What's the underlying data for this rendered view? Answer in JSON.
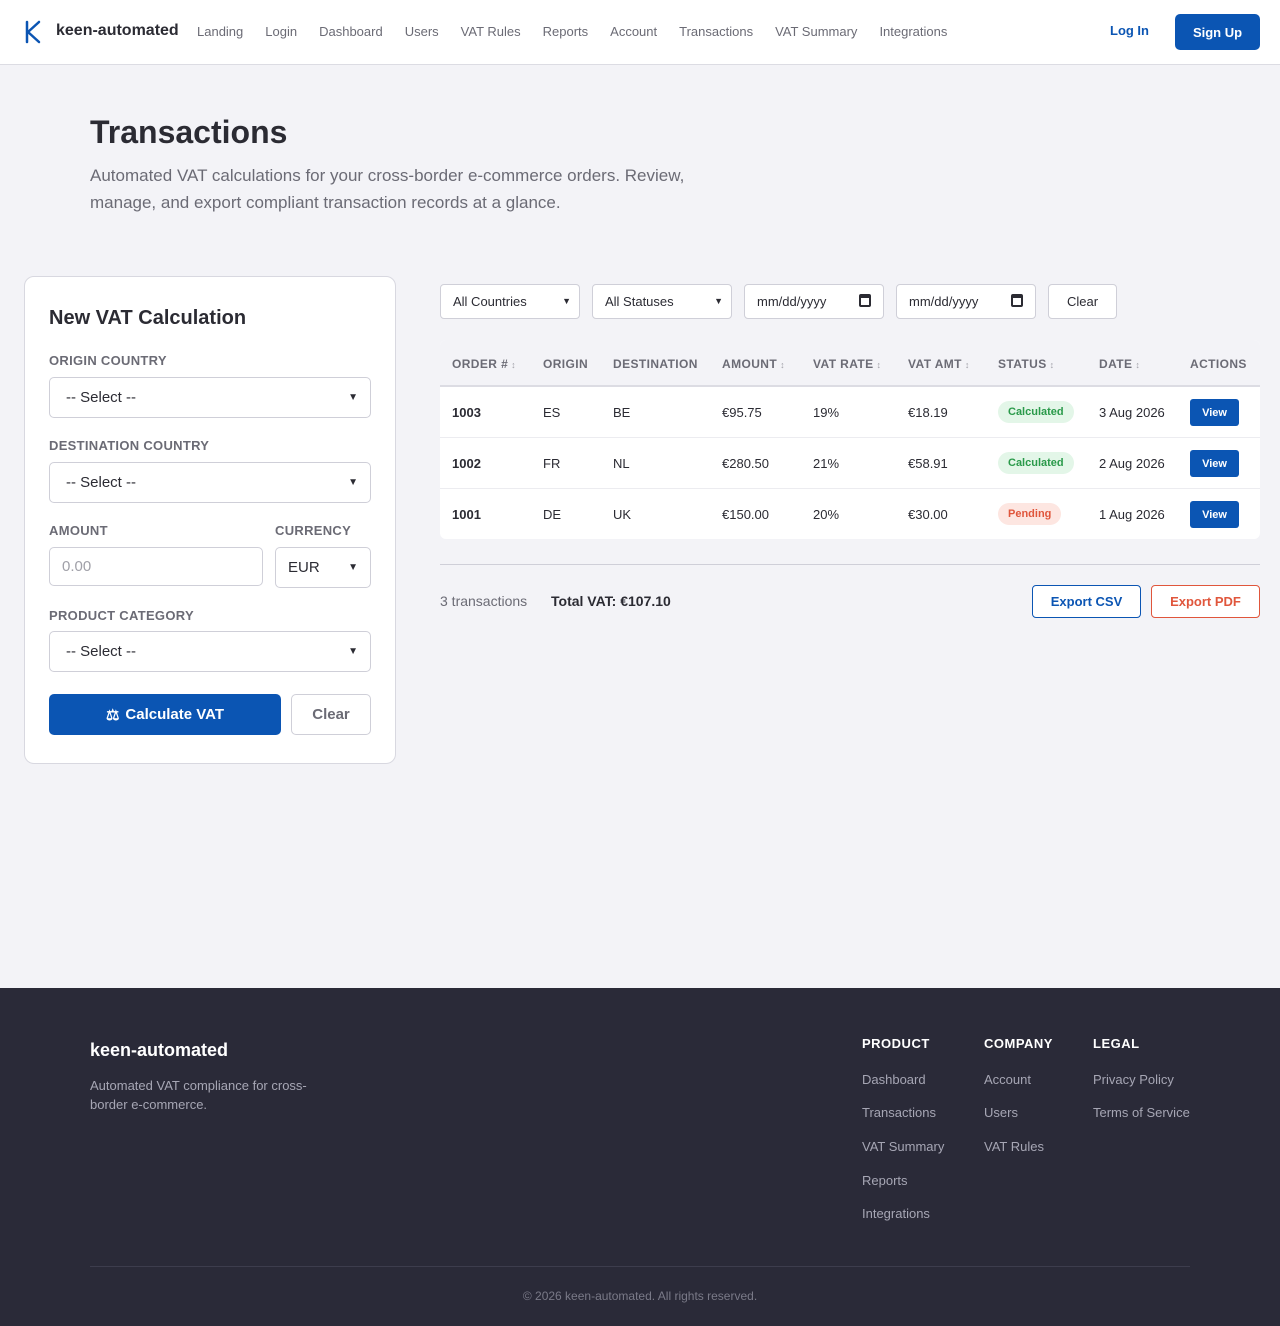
{
  "header": {
    "brand": "keen-automated",
    "nav": [
      "Landing",
      "Login",
      "Dashboard",
      "Users",
      "VAT Rules",
      "Reports",
      "Account",
      "Transactions",
      "VAT Summary",
      "Integrations"
    ],
    "login_label": "Log In",
    "signup_label": "Sign Up",
    "accent_color": "#0b55b3"
  },
  "hero": {
    "title": "Transactions",
    "subtitle": "Automated VAT calculations for your cross-border e-commerce orders. Review, manage, and export compliant transaction records at a glance."
  },
  "form": {
    "title": "New VAT Calculation",
    "origin_label": "ORIGIN COUNTRY",
    "origin_value": "-- Select --",
    "destination_label": "DESTINATION COUNTRY",
    "destination_value": "-- Select --",
    "amount_label": "AMOUNT",
    "amount_placeholder": "0.00",
    "currency_label": "CURRENCY",
    "currency_value": "EUR",
    "category_label": "PRODUCT CATEGORY",
    "category_value": "-- Select --",
    "calculate_icon": "⚖",
    "calculate_label": "Calculate VAT",
    "clear_label": "Clear"
  },
  "filters": {
    "country": "All Countries",
    "status": "All Statuses",
    "date_from": "mm/dd/yyyy",
    "date_to": "mm/dd/yyyy",
    "clear_label": "Clear"
  },
  "table": {
    "headers": [
      "ORDER #",
      "ORIGIN",
      "DESTINATION",
      "AMOUNT",
      "VAT RATE",
      "VAT AMT",
      "STATUS",
      "DATE",
      "ACTIONS"
    ],
    "sort_glyph": "↕",
    "rows": [
      {
        "order": "1003",
        "origin": "ES",
        "destination": "BE",
        "amount": "€95.75",
        "vat_rate": "19%",
        "vat_amt": "€18.19",
        "status": "Calculated",
        "date": "3 Aug 2026",
        "action": "View"
      },
      {
        "order": "1002",
        "origin": "FR",
        "destination": "NL",
        "amount": "€280.50",
        "vat_rate": "21%",
        "vat_amt": "€58.91",
        "status": "Calculated",
        "date": "2 Aug 2026",
        "action": "View"
      },
      {
        "order": "1001",
        "origin": "DE",
        "destination": "UK",
        "amount": "€150.00",
        "vat_rate": "20%",
        "vat_amt": "€30.00",
        "status": "Pending",
        "date": "1 Aug 2026",
        "action": "View"
      }
    ]
  },
  "summary": {
    "count": "3 transactions",
    "total_vat": "Total VAT: €107.10",
    "export_csv": "Export CSV",
    "export_pdf": "Export PDF"
  },
  "footer": {
    "brand": "keen-automated",
    "tagline": "Automated VAT compliance for cross-border e-commerce.",
    "product_title": "PRODUCT",
    "product_links": [
      "Dashboard",
      "Transactions",
      "VAT Summary",
      "Reports",
      "Integrations"
    ],
    "company_title": "COMPANY",
    "company_links": [
      "Account",
      "Users",
      "VAT Rules"
    ],
    "legal_title": "LEGAL",
    "legal_links": [
      "Privacy Policy",
      "Terms of Service"
    ],
    "copyright": "© 2026 keen-automated. All rights reserved."
  }
}
